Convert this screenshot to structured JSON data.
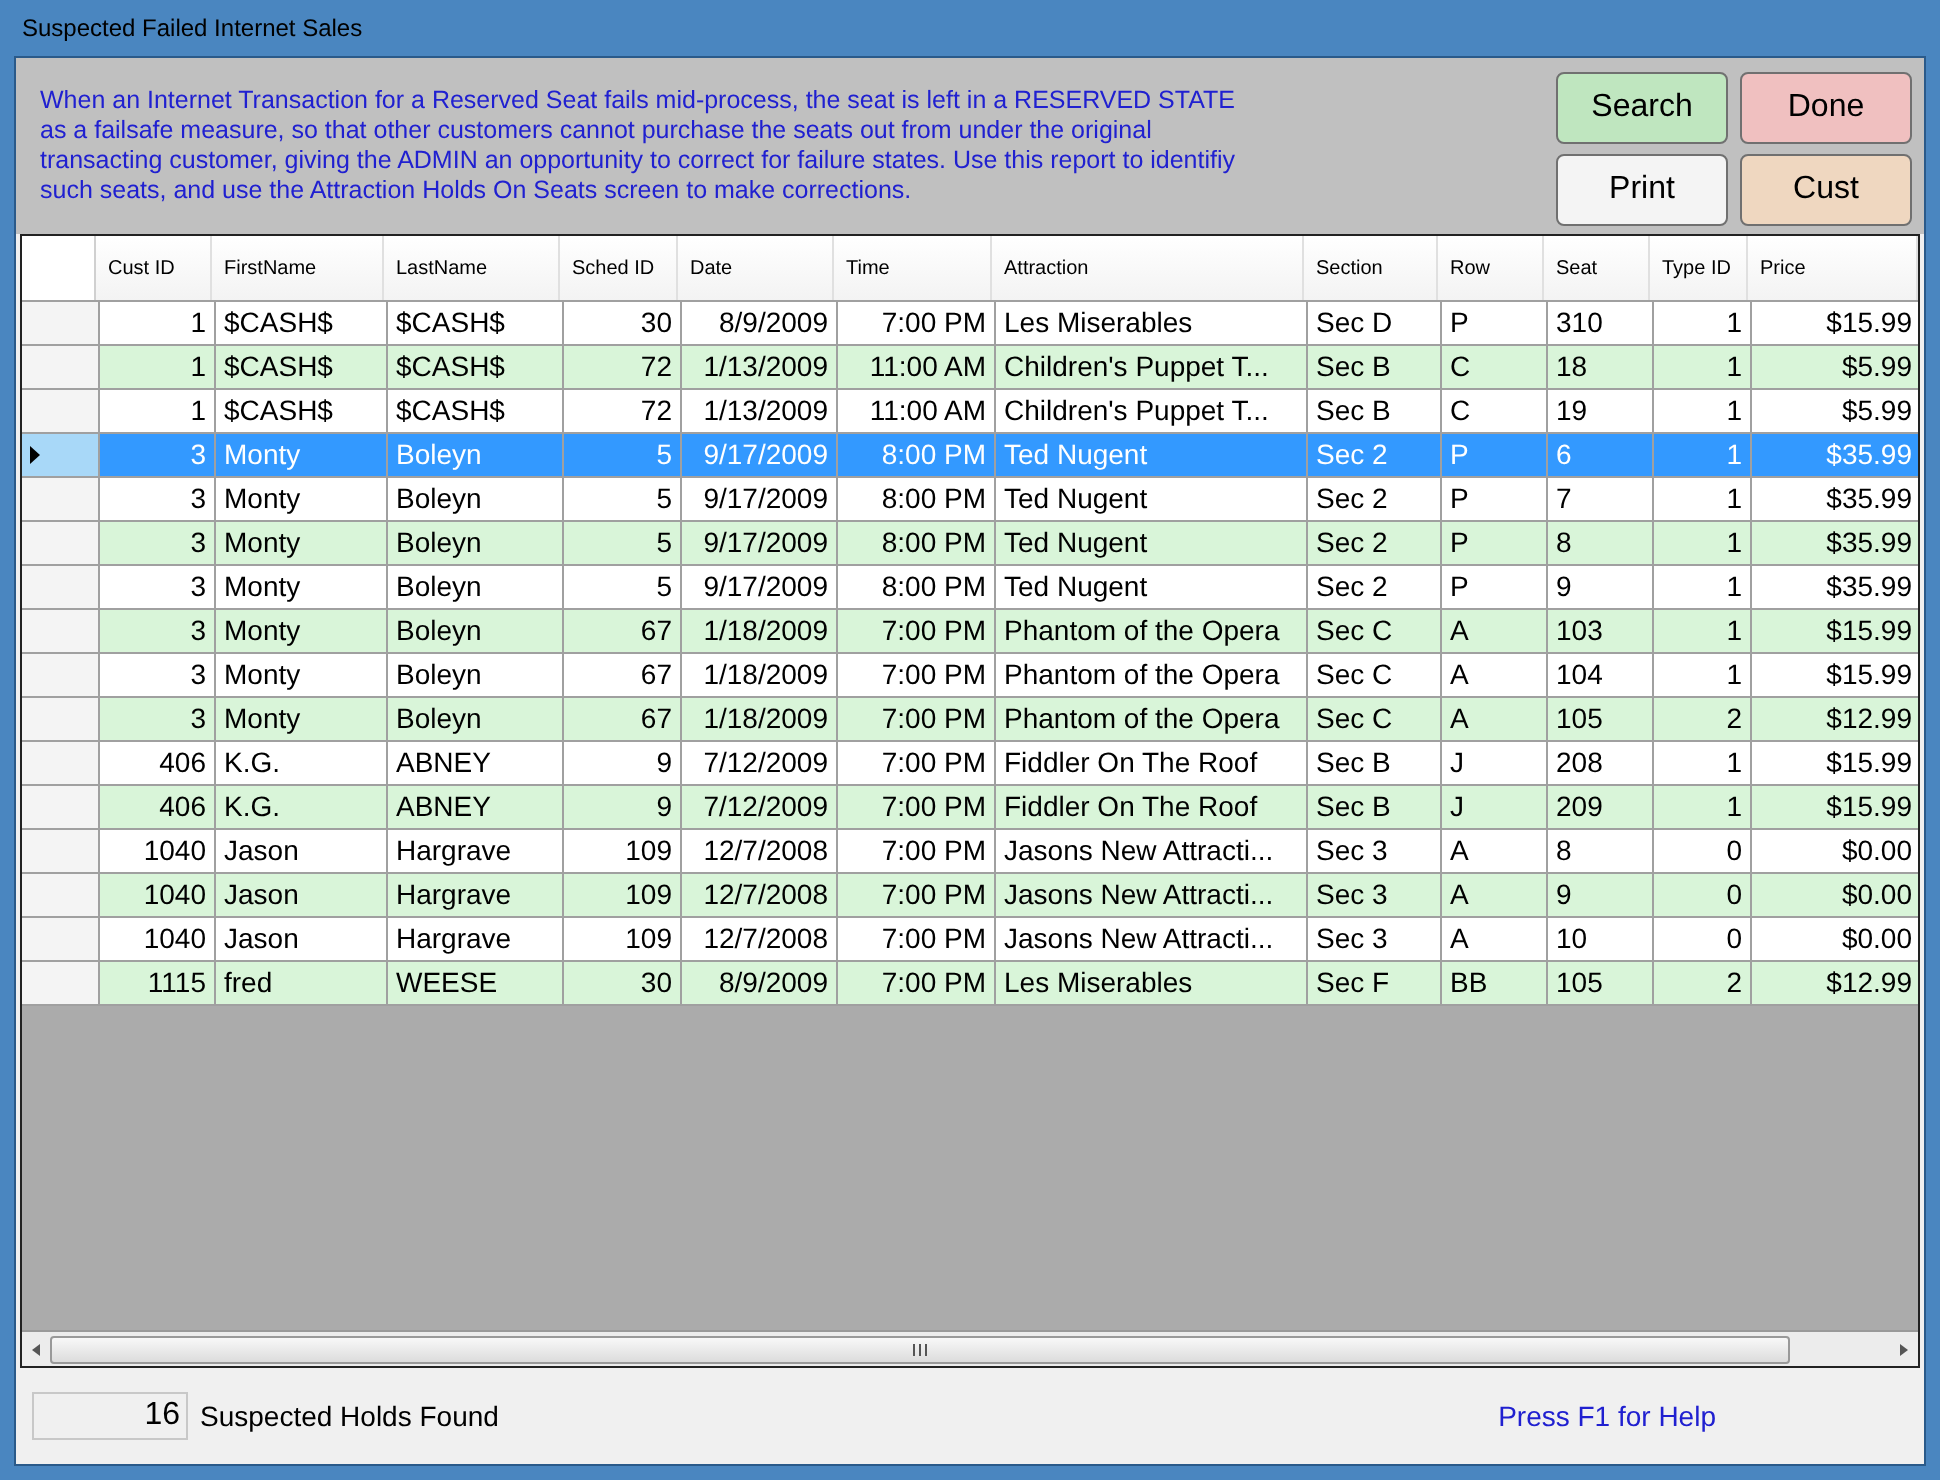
{
  "window": {
    "title": "Suspected Failed Internet Sales"
  },
  "description": "When an Internet Transaction for a Reserved Seat fails mid-process, the seat is left in a RESERVED STATE as a failsafe measure, so that other customers cannot purchase the seats out from under the original transacting customer, giving the ADMIN an opportunity to correct for failure states.  Use this report to identifiy such seats, and use the Attraction Holds On Seats screen to make corrections.",
  "buttons": [
    {
      "label": "Search",
      "color": "#bfe6bf"
    },
    {
      "label": "Done",
      "color": "#f0c0c0"
    },
    {
      "label": "Print",
      "color": "#f4f4f4"
    },
    {
      "label": "Cust",
      "color": "#efd7c0"
    }
  ],
  "table": {
    "columns": [
      {
        "label": "Cust ID",
        "kind": "number"
      },
      {
        "label": "FirstName",
        "kind": "text"
      },
      {
        "label": "LastName",
        "kind": "text"
      },
      {
        "label": "Sched ID",
        "kind": "number"
      },
      {
        "label": "Date",
        "kind": "number"
      },
      {
        "label": "Time",
        "kind": "number"
      },
      {
        "label": "Attraction",
        "kind": "text"
      },
      {
        "label": "Section",
        "kind": "text"
      },
      {
        "label": "Row",
        "kind": "text"
      },
      {
        "label": "Seat",
        "kind": "text"
      },
      {
        "label": "Type ID",
        "kind": "number"
      },
      {
        "label": "Price",
        "kind": "number"
      }
    ],
    "rows": [
      {
        "selected": false,
        "cells": [
          "1",
          "$CASH$",
          "$CASH$",
          "30",
          "8/9/2009",
          "7:00 PM",
          "Les Miserables",
          "Sec D",
          "P",
          "310",
          "1",
          "$15.99"
        ]
      },
      {
        "selected": false,
        "cells": [
          "1",
          "$CASH$",
          "$CASH$",
          "72",
          "1/13/2009",
          "11:00 AM",
          "Children's Puppet T...",
          "Sec B",
          "C",
          "18",
          "1",
          "$5.99"
        ]
      },
      {
        "selected": false,
        "cells": [
          "1",
          "$CASH$",
          "$CASH$",
          "72",
          "1/13/2009",
          "11:00 AM",
          "Children's Puppet T...",
          "Sec B",
          "C",
          "19",
          "1",
          "$5.99"
        ]
      },
      {
        "selected": true,
        "cells": [
          "3",
          "Monty",
          "Boleyn",
          "5",
          "9/17/2009",
          "8:00 PM",
          "Ted Nugent",
          "Sec 2",
          "P",
          "6",
          "1",
          "$35.99"
        ]
      },
      {
        "selected": false,
        "cells": [
          "3",
          "Monty",
          "Boleyn",
          "5",
          "9/17/2009",
          "8:00 PM",
          "Ted Nugent",
          "Sec 2",
          "P",
          "7",
          "1",
          "$35.99"
        ]
      },
      {
        "selected": false,
        "cells": [
          "3",
          "Monty",
          "Boleyn",
          "5",
          "9/17/2009",
          "8:00 PM",
          "Ted Nugent",
          "Sec 2",
          "P",
          "8",
          "1",
          "$35.99"
        ]
      },
      {
        "selected": false,
        "cells": [
          "3",
          "Monty",
          "Boleyn",
          "5",
          "9/17/2009",
          "8:00 PM",
          "Ted Nugent",
          "Sec 2",
          "P",
          "9",
          "1",
          "$35.99"
        ]
      },
      {
        "selected": false,
        "cells": [
          "3",
          "Monty",
          "Boleyn",
          "67",
          "1/18/2009",
          "7:00 PM",
          "Phantom of the Opera",
          "Sec C",
          "A",
          "103",
          "1",
          "$15.99"
        ]
      },
      {
        "selected": false,
        "cells": [
          "3",
          "Monty",
          "Boleyn",
          "67",
          "1/18/2009",
          "7:00 PM",
          "Phantom of the Opera",
          "Sec C",
          "A",
          "104",
          "1",
          "$15.99"
        ]
      },
      {
        "selected": false,
        "cells": [
          "3",
          "Monty",
          "Boleyn",
          "67",
          "1/18/2009",
          "7:00 PM",
          "Phantom of the Opera",
          "Sec C",
          "A",
          "105",
          "2",
          "$12.99"
        ]
      },
      {
        "selected": false,
        "cells": [
          "406",
          "K.G.",
          "ABNEY",
          "9",
          "7/12/2009",
          "7:00 PM",
          "Fiddler On The Roof",
          "Sec B",
          "J",
          "208",
          "1",
          "$15.99"
        ]
      },
      {
        "selected": false,
        "cells": [
          "406",
          "K.G.",
          "ABNEY",
          "9",
          "7/12/2009",
          "7:00 PM",
          "Fiddler On The Roof",
          "Sec B",
          "J",
          "209",
          "1",
          "$15.99"
        ]
      },
      {
        "selected": false,
        "cells": [
          "1040",
          "Jason",
          "Hargrave",
          "109",
          "12/7/2008",
          "7:00 PM",
          "Jasons New Attracti...",
          "Sec 3",
          "A",
          "8",
          "0",
          "$0.00"
        ]
      },
      {
        "selected": false,
        "cells": [
          "1040",
          "Jason",
          "Hargrave",
          "109",
          "12/7/2008",
          "7:00 PM",
          "Jasons New Attracti...",
          "Sec 3",
          "A",
          "9",
          "0",
          "$0.00"
        ]
      },
      {
        "selected": false,
        "cells": [
          "1040",
          "Jason",
          "Hargrave",
          "109",
          "12/7/2008",
          "7:00 PM",
          "Jasons New Attracti...",
          "Sec 3",
          "A",
          "10",
          "0",
          "$0.00"
        ]
      },
      {
        "selected": false,
        "cells": [
          "1115",
          "fred",
          "WEESE",
          "30",
          "8/9/2009",
          "7:00 PM",
          "Les Miserables",
          "Sec F",
          "BB",
          "105",
          "2",
          "$12.99"
        ]
      }
    ]
  },
  "status_bar": {
    "count": "16",
    "count_label": "Suspected Holds Found",
    "help": "Press F1 for Help"
  }
}
